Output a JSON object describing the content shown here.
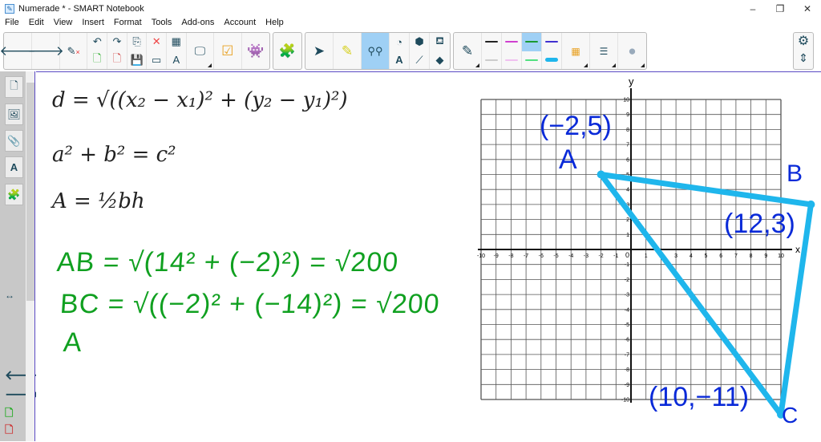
{
  "window": {
    "title": "Numerade * - SMART Notebook",
    "minimize": "–",
    "restore": "❐",
    "close": "✕"
  },
  "menu": [
    "File",
    "Edit",
    "View",
    "Insert",
    "Format",
    "Tools",
    "Add-ons",
    "Account",
    "Help"
  ],
  "colors": {
    "accent": "#9fd0f5",
    "pen_green": "#10a020",
    "pen_blue": "#0a2ad8",
    "triangle": "#1fb6ec"
  },
  "formulas": {
    "distance": "d = √((x₂ − x₁)² + (y₂ − y₁)²)",
    "pythagorean": "a² + b² = c²",
    "area": "A = ½bh"
  },
  "handwriting": {
    "line1": "AB = √(14² + (−2)²) = √200",
    "line2": "BC = √((−2)² + (−14)²) = √200",
    "line3": "A"
  },
  "graph": {
    "x_label": "x",
    "y_label": "y",
    "origin_label": "0",
    "range": [
      -10,
      10
    ],
    "points": [
      {
        "name": "A",
        "label": "(−2,5)",
        "x": -2,
        "y": 5
      },
      {
        "name": "B",
        "label": "(12,3)",
        "x": 12,
        "y": 3
      },
      {
        "name": "C",
        "label": "(10,−11)",
        "x": 10,
        "y": -11
      }
    ]
  }
}
